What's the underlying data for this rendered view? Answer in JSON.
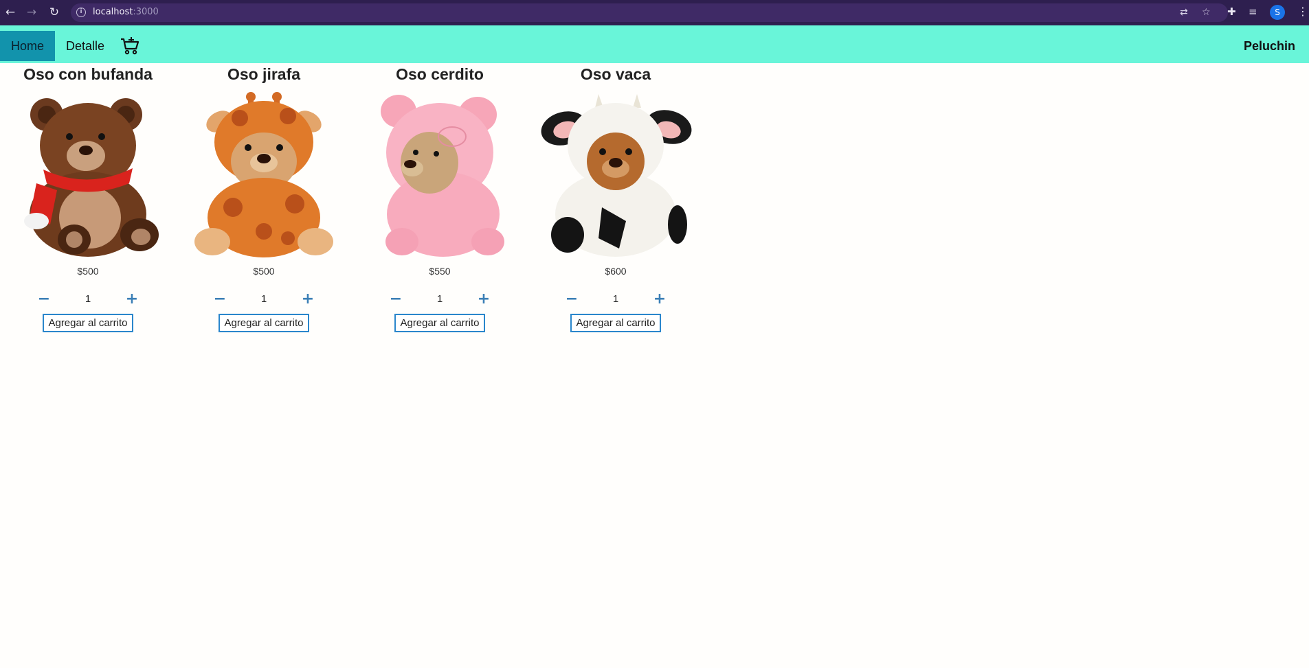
{
  "browser": {
    "url_host": "localhost",
    "url_port": ":3000",
    "profile_initial": "S"
  },
  "navbar": {
    "home_label": "Home",
    "detalle_label": "Detalle",
    "brand": "Peluchin"
  },
  "products": [
    {
      "name": "Oso con bufanda",
      "price": "$500",
      "quantity": "1",
      "add_label": "Agregar al carrito"
    },
    {
      "name": "Oso jirafa",
      "price": "$500",
      "quantity": "1",
      "add_label": "Agregar al carrito"
    },
    {
      "name": "Oso cerdito",
      "price": "$550",
      "quantity": "1",
      "add_label": "Agregar al carrito"
    },
    {
      "name": "Oso vaca",
      "price": "$600",
      "quantity": "1",
      "add_label": "Agregar al carrito"
    }
  ],
  "colors": {
    "navbar_bg": "#69f5d9",
    "home_active_bg": "#1293ac",
    "button_border": "#2a86cc",
    "browser_chrome": "#2e1f4f"
  }
}
